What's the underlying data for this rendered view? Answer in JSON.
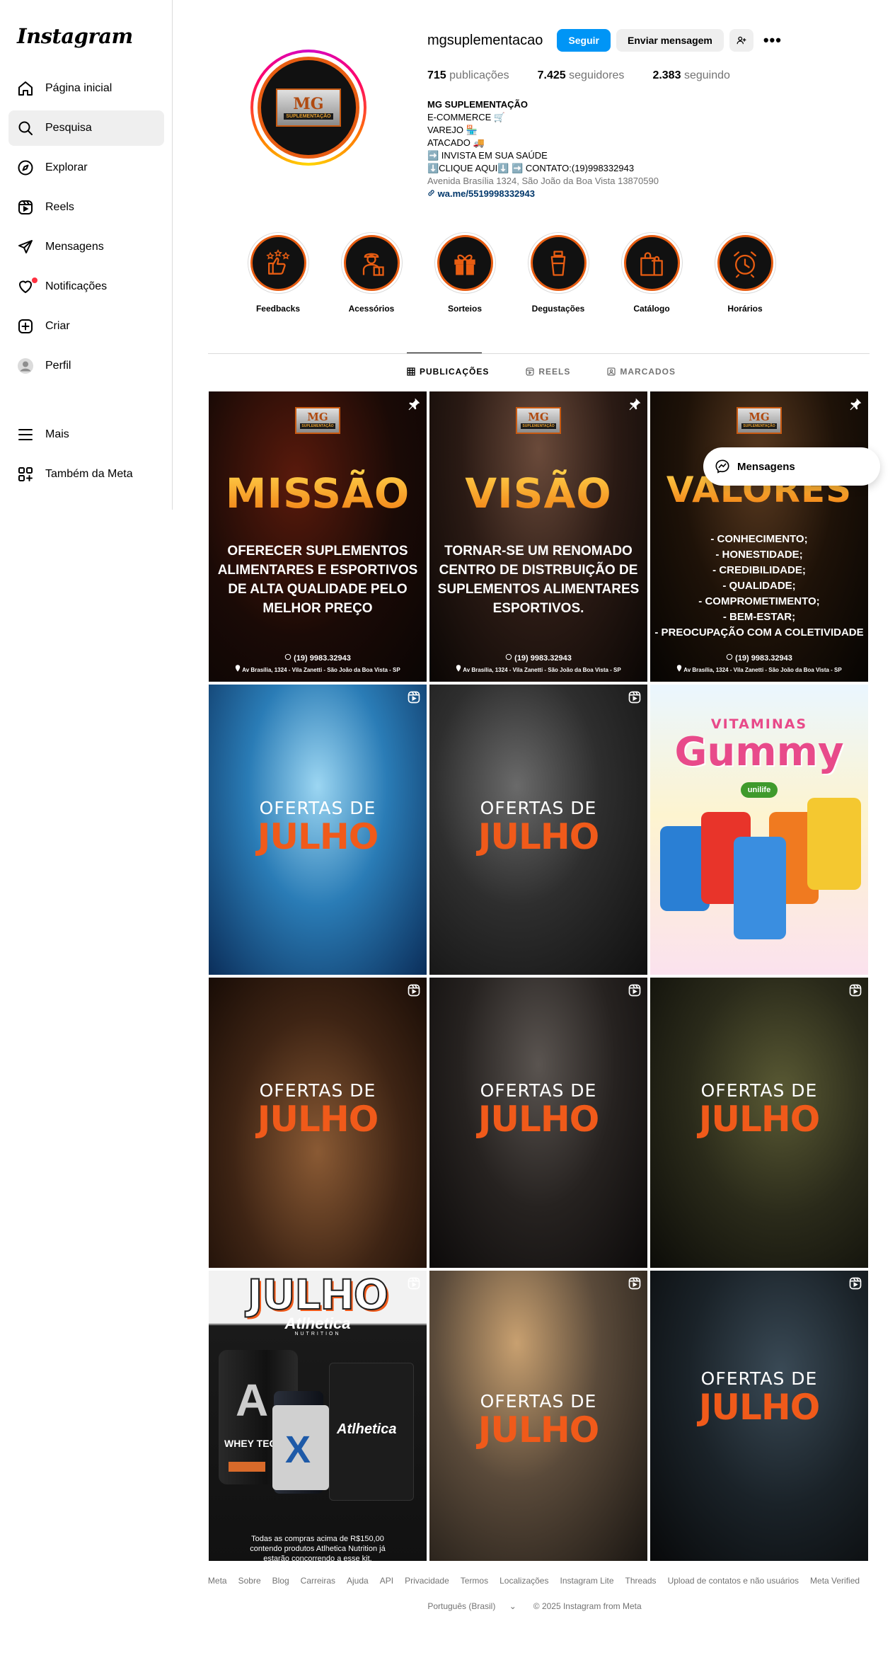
{
  "sidebar": {
    "logo": "Instagram",
    "items": [
      {
        "label": "Página inicial",
        "icon": "home-icon"
      },
      {
        "label": "Pesquisa",
        "icon": "search-icon"
      },
      {
        "label": "Explorar",
        "icon": "compass-icon"
      },
      {
        "label": "Reels",
        "icon": "reels-icon"
      },
      {
        "label": "Mensagens",
        "icon": "send-icon"
      },
      {
        "label": "Notificações",
        "icon": "heart-icon"
      },
      {
        "label": "Criar",
        "icon": "plus-square-icon"
      },
      {
        "label": "Perfil",
        "icon": "avatar-icon"
      }
    ],
    "bottom": [
      {
        "label": "Mais",
        "icon": "menu-icon"
      },
      {
        "label": "Também da Meta",
        "icon": "meta-grid-icon"
      }
    ]
  },
  "profile": {
    "username": "mgsuplementacao",
    "follow_label": "Seguir",
    "message_label": "Enviar mensagem",
    "more_label": "•••",
    "stats": {
      "posts_count": "715",
      "posts_label": "publicações",
      "followers_count": "7.425",
      "followers_label": "seguidores",
      "following_count": "2.383",
      "following_label": "seguindo"
    },
    "avatar_text": {
      "mg": "MG",
      "sub": "SUPLEMENTAÇÃO"
    },
    "bio": {
      "name": "MG SUPLEMENTAÇÃO",
      "lines": [
        "E-COMMERCE 🛒",
        "VAREJO 🏪",
        "ATACADO 🚚",
        "➡️ INVISTA EM SUA SAÚDE",
        "⬇️CLIQUE AQUI⬇️ ➡️ CONTATO:(19)998332943"
      ],
      "address": "Avenida Brasília 1324, São João da Boa Vista 13870590",
      "link": "wa.me/5519998332943"
    }
  },
  "highlights": [
    {
      "label": "Feedbacks",
      "icon": "thumbs-up-stars-icon"
    },
    {
      "label": "Acessórios",
      "icon": "delivery-person-icon"
    },
    {
      "label": "Sorteios",
      "icon": "gift-icon"
    },
    {
      "label": "Degustações",
      "icon": "shaker-icon"
    },
    {
      "label": "Catálogo",
      "icon": "shopping-bags-icon"
    },
    {
      "label": "Horários",
      "icon": "alarm-clock-icon"
    }
  ],
  "tabs": [
    {
      "label": "PUBLICAÇÕES",
      "icon": "grid-icon",
      "active": true
    },
    {
      "label": "REELS",
      "icon": "reels-icon",
      "active": false
    },
    {
      "label": "MARCADOS",
      "icon": "tagged-icon",
      "active": false
    }
  ],
  "posts": {
    "mission": {
      "title": "MISSÃO",
      "text": "OFERECER SUPLEMENTOS ALIMENTARES E ESPORTIVOS DE ALTA QUALIDADE PELO MELHOR PREÇO",
      "phone": "(19) 9983.32943",
      "address": "Av Brasília, 1324 - Vila Zanetti - São João da Boa Vista - SP"
    },
    "visao": {
      "title": "VISÃO",
      "text": "TORNAR-SE UM RENOMADO CENTRO DE DISTRBUIÇÃO DE SUPLEMENTOS ALIMENTARES ESPORTIVOS.",
      "phone": "(19) 9983.32943",
      "address": "Av Brasília, 1324 - Vila Zanetti - São João da Boa Vista - SP"
    },
    "valores": {
      "title": "VALORES",
      "items": [
        "- CONHECIMENTO;",
        "- HONESTIDADE;",
        "- CREDIBILIDADE;",
        "- QUALIDADE;",
        "- COMPROMETIMENTO;",
        "- BEM-ESTAR;",
        "- PREOCUPAÇÃO COM A COLETIVIDADE"
      ],
      "phone": "(19) 9983.32943",
      "address": "Av Brasília, 1324 - Vila Zanetti - São João da Boa Vista - SP"
    },
    "ofertas": {
      "line1": "OFERTAS DE",
      "line2": "JULHO"
    },
    "gummy": {
      "line1": "VITAMINAS",
      "line2": "Gummy",
      "brand": "unilife"
    },
    "athletica": {
      "title": "JULHO",
      "brand": "Atlhetica",
      "sub": "NUTRITION",
      "product": "WHEY TECH",
      "bag": "Atlhetica",
      "footer": "Todas as compras acima de R$150,00 contendo produtos Atlhetica Nutrition já estarão concorrendo a esse kit."
    }
  },
  "messages_popup": {
    "label": "Mensagens"
  },
  "footer": {
    "links": [
      "Meta",
      "Sobre",
      "Blog",
      "Carreiras",
      "Ajuda",
      "API",
      "Privacidade",
      "Termos",
      "Localizações",
      "Instagram Lite",
      "Threads",
      "Upload de contatos e não usuários",
      "Meta Verified"
    ],
    "language": "Português (Brasil)",
    "copyright": "© 2025 Instagram from Meta"
  },
  "colors": {
    "primary": "#0095f6",
    "accent": "#e85d12",
    "julho": "#f05a1a",
    "muted": "#737373"
  }
}
